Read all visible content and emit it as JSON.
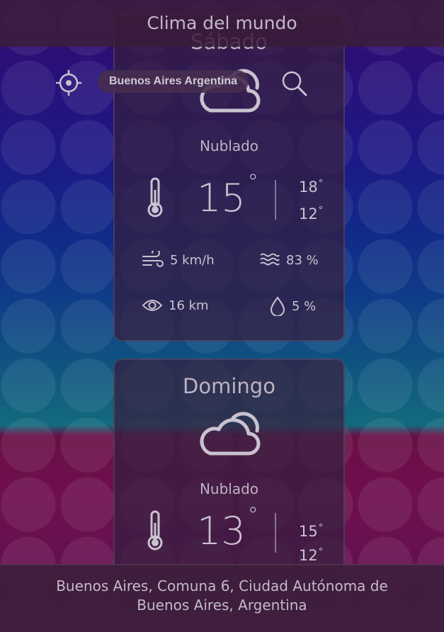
{
  "app": {
    "title": "Clima del mundo"
  },
  "location": {
    "query": "Buenos Aires Argentina",
    "address": "Buenos Aires, Comuna 6, Ciudad Autónoma de Buenos Aires, Argentina"
  },
  "forecast": [
    {
      "day": "Sábado",
      "condition": "Nublado",
      "icon": "cloud-icon",
      "temp": "15",
      "high": "18",
      "low": "12",
      "wind": "5 km/h",
      "humidity": "83 %",
      "visibility": "16 km",
      "rain": "5 %"
    },
    {
      "day": "Domingo",
      "condition": "Nublado",
      "icon": "cloud-icon",
      "temp": "13",
      "high": "15",
      "low": "12"
    }
  ],
  "colors": {
    "text": "#c9c2cf",
    "card": "#341e3e",
    "footer": "#3e1e3c"
  }
}
